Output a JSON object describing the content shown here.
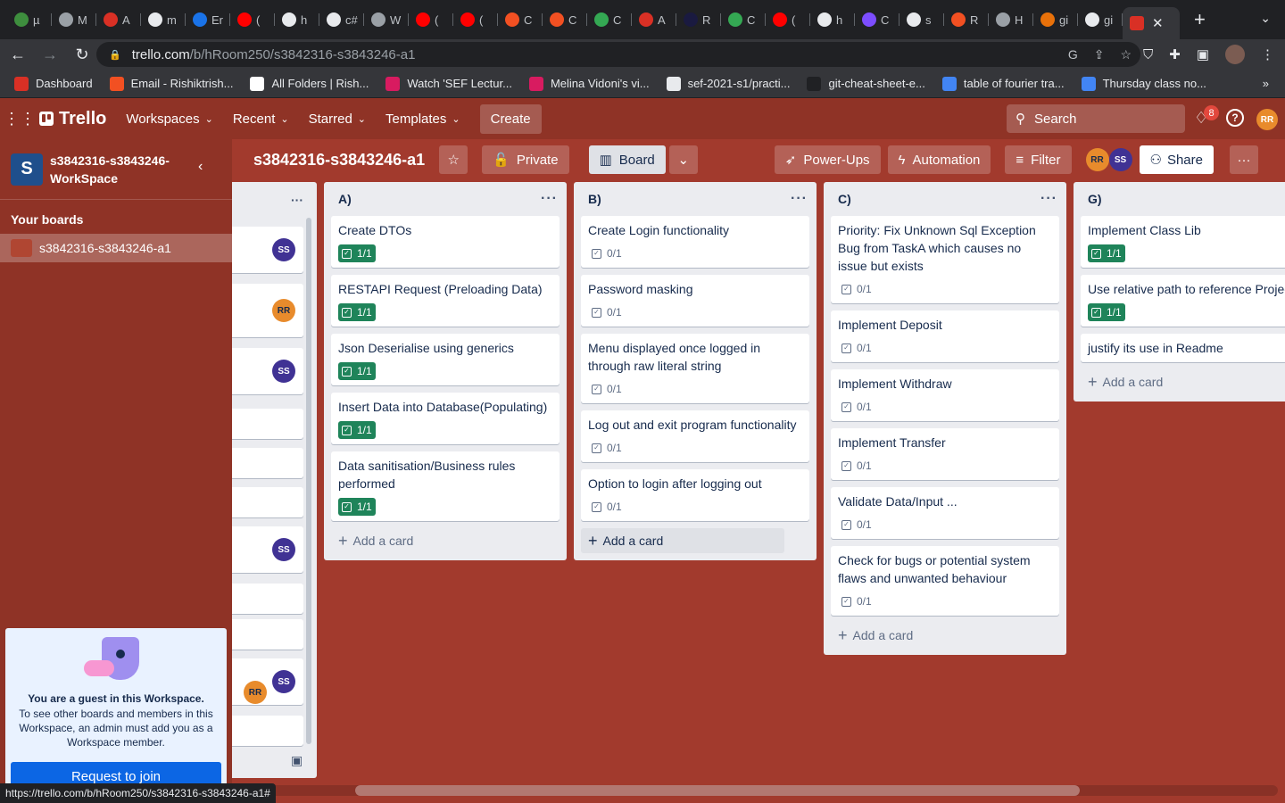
{
  "browser": {
    "tabs": [
      {
        "label": "µ",
        "color": "#3e8e3e"
      },
      {
        "label": "M",
        "color": "#9aa0a6"
      },
      {
        "label": "A",
        "color": "#d93025"
      },
      {
        "label": "m",
        "color": "#e8eaed"
      },
      {
        "label": "Er",
        "color": "#1a73e8"
      },
      {
        "label": "(",
        "color": "#ff0000"
      },
      {
        "label": "h",
        "color": "#e8eaed"
      },
      {
        "label": "c#",
        "color": "#e8eaed"
      },
      {
        "label": "W",
        "color": "#9aa0a6"
      },
      {
        "label": "(",
        "color": "#ff0000"
      },
      {
        "label": "(",
        "color": "#ff0000"
      },
      {
        "label": "C",
        "color": "#f25022"
      },
      {
        "label": "C",
        "color": "#f25022"
      },
      {
        "label": "C",
        "color": "#34a853"
      },
      {
        "label": "A",
        "color": "#d93025"
      },
      {
        "label": "R",
        "color": "#1a1a40"
      },
      {
        "label": "C",
        "color": "#34a853"
      },
      {
        "label": "(",
        "color": "#ff0000"
      },
      {
        "label": "h",
        "color": "#e8eaed"
      },
      {
        "label": "C",
        "color": "#7c4dff"
      },
      {
        "label": "s",
        "color": "#e8eaed"
      },
      {
        "label": "R",
        "color": "#f25022"
      },
      {
        "label": "H",
        "color": "#9aa0a6"
      },
      {
        "label": "gi",
        "color": "#e8710a"
      },
      {
        "label": "gi",
        "color": "#e8eaed"
      }
    ],
    "active_tab_color": "#d93025",
    "url_host": "trello.com",
    "url_path": "/b/hRoom250/s3842316-s3843246-a1",
    "status_url": "https://trello.com/b/hRoom250/s3842316-s3843246-a1#",
    "bookmarks": [
      {
        "label": "Dashboard",
        "color": "#d93025"
      },
      {
        "label": "Email - Rishiktrish...",
        "color": "#f25022"
      },
      {
        "label": "All Folders | Rish...",
        "color": "#ffffff"
      },
      {
        "label": "Watch 'SEF Lectur...",
        "color": "#d81b60"
      },
      {
        "label": "Melina Vidoni's vi...",
        "color": "#d81b60"
      },
      {
        "label": "sef-2021-s1/practi...",
        "color": "#e8eaed"
      },
      {
        "label": "git-cheat-sheet-e...",
        "color": "#202124"
      },
      {
        "label": "table of fourier tra...",
        "color": "#4285f4"
      },
      {
        "label": "Thursday class no...",
        "color": "#4285f4"
      }
    ],
    "bookmarks_more": "»"
  },
  "header": {
    "logo": "Trello",
    "menus": [
      "Workspaces",
      "Recent",
      "Starred",
      "Templates"
    ],
    "create": "Create",
    "search_placeholder": "Search",
    "notification_count": "8",
    "user_initials": "RR"
  },
  "sidebar": {
    "workspace_letter": "S",
    "workspace_name": "s3842316-s3843246-WorkSpace",
    "your_boards": "Your boards",
    "board": "s3842316-s3843246-a1",
    "guest_title": "You are a guest in this Workspace.",
    "guest_text": "To see other boards and members in this Workspace, an admin must add you as a Workspace member.",
    "join_button": "Request to join"
  },
  "board": {
    "title": "s3842316-s3843246-a1",
    "visibility": "Private",
    "view": "Board",
    "powerups": "Power-Ups",
    "automation": "Automation",
    "filter": "Filter",
    "members": [
      "RR",
      "SS"
    ],
    "share": "Share"
  },
  "hidden_list": {
    "avatars": [
      "SS",
      "RR",
      "SS",
      "SS",
      "RR",
      "SS"
    ]
  },
  "lists": [
    {
      "title": "A)",
      "add_card": "Add a card",
      "cards": [
        {
          "title": "Create DTOs",
          "checklist": "1/1",
          "complete": true
        },
        {
          "title": "RESTAPI Request (Preloading Data)",
          "checklist": "1/1",
          "complete": true
        },
        {
          "title": "Json Deserialise using generics",
          "checklist": "1/1",
          "complete": true
        },
        {
          "title": "Insert Data into Database(Populating)",
          "checklist": "1/1",
          "complete": true
        },
        {
          "title": "Data sanitisation/Business rules performed",
          "checklist": "1/1",
          "complete": true
        }
      ]
    },
    {
      "title": "B)",
      "add_card": "Add a card",
      "cards": [
        {
          "title": "Create Login functionality",
          "checklist": "0/1",
          "complete": false
        },
        {
          "title": "Password masking",
          "checklist": "0/1",
          "complete": false
        },
        {
          "title": "Menu displayed once logged in through raw literal string",
          "checklist": "0/1",
          "complete": false
        },
        {
          "title": "Log out and exit program functionality",
          "checklist": "0/1",
          "complete": false
        },
        {
          "title": "Option to login after logging out",
          "checklist": "0/1",
          "complete": false
        }
      ]
    },
    {
      "title": "C)",
      "add_card": "Add a card",
      "cards": [
        {
          "title": "Priority: Fix Unknown Sql Exception Bug from TaskA which causes no issue but exists",
          "checklist": "0/1",
          "complete": false
        },
        {
          "title": "Implement Deposit",
          "checklist": "0/1",
          "complete": false
        },
        {
          "title": "Implement Withdraw",
          "checklist": "0/1",
          "complete": false
        },
        {
          "title": "Implement Transfer",
          "checklist": "0/1",
          "complete": false
        },
        {
          "title": "Validate Data/Input ...",
          "checklist": "0/1",
          "complete": false
        },
        {
          "title": "Check for bugs or potential system flaws and unwanted behaviour",
          "checklist": "0/1",
          "complete": false
        }
      ]
    },
    {
      "title": "G)",
      "add_card": "Add a card",
      "cards": [
        {
          "title": "Implement Class Lib",
          "checklist": "1/1",
          "complete": true
        },
        {
          "title": "Use relative path to reference Projects",
          "checklist": "1/1",
          "complete": true
        },
        {
          "title": "justify its use in Readme",
          "checklist": "",
          "complete": false
        }
      ]
    }
  ],
  "colors": {
    "board_bg": "#a23a2d",
    "header_bg": "#8f3326",
    "complete_badge": "#1f845a"
  }
}
